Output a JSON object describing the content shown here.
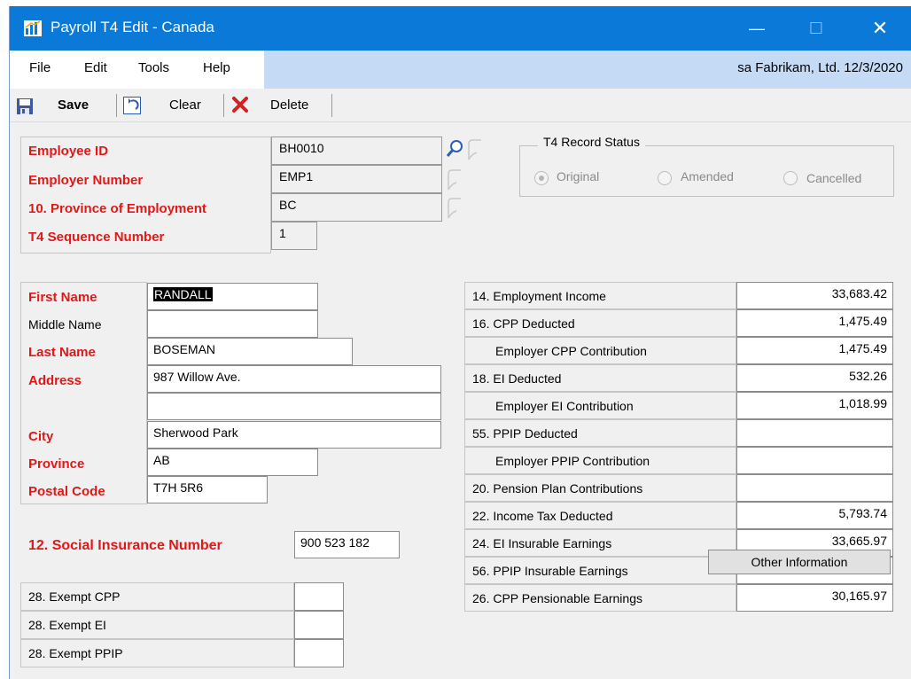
{
  "window": {
    "title": "Payroll T4 Edit - Canada",
    "controls": {
      "minimize": "—",
      "maximize": "☐",
      "close": "✕"
    }
  },
  "menu": {
    "items": [
      "File",
      "Edit",
      "Tools",
      "Help"
    ],
    "status": "sa  Fabrikam, Ltd.  12/3/2020"
  },
  "toolbar": {
    "save": "Save",
    "clear": "Clear",
    "delete": "Delete"
  },
  "header": {
    "employee_id_label": "Employee ID",
    "employee_id": "BH0010",
    "employer_number_label": "Employer Number",
    "employer_number": "EMP1",
    "province_employment_label": "10. Province of Employment",
    "province_employment": "BC",
    "sequence_label": "T4 Sequence Number",
    "sequence": "1"
  },
  "record_status": {
    "label": "T4 Record Status",
    "options": [
      "Original",
      "Amended",
      "Cancelled"
    ],
    "selected": "Original"
  },
  "employee": {
    "first_name_label": "First Name",
    "first_name": "RANDALL",
    "middle_name_label": "Middle Name",
    "middle_name": "",
    "last_name_label": "Last Name",
    "last_name": "BOSEMAN",
    "address_label": "Address",
    "address_1": "987 Willow Ave.",
    "address_2": "",
    "city_label": "City",
    "city": "Sherwood Park",
    "province_label": "Province",
    "province": "AB",
    "postal_code_label": "Postal Code",
    "postal_code": "T7H 5R6",
    "sin_label": "12. Social Insurance Number",
    "sin": "900 523 182"
  },
  "exempt": [
    {
      "label": "28. Exempt CPP",
      "value": ""
    },
    {
      "label": "28. Exempt EI",
      "value": ""
    },
    {
      "label": "28. Exempt PPIP",
      "value": ""
    }
  ],
  "amounts": [
    {
      "label": "14. Employment Income",
      "value": "33,683.42",
      "indent": false
    },
    {
      "label": "16. CPP Deducted",
      "value": "1,475.49",
      "indent": false
    },
    {
      "label": "Employer CPP Contribution",
      "value": "1,475.49",
      "indent": true
    },
    {
      "label": "18. EI Deducted",
      "value": "532.26",
      "indent": false
    },
    {
      "label": "Employer EI Contribution",
      "value": "1,018.99",
      "indent": true
    },
    {
      "label": "55. PPIP Deducted",
      "value": "",
      "indent": false
    },
    {
      "label": "Employer PPIP Contribution",
      "value": "",
      "indent": true
    },
    {
      "label": "20. Pension Plan Contributions",
      "value": "",
      "indent": false
    },
    {
      "label": "22. Income Tax Deducted",
      "value": "5,793.74",
      "indent": false
    },
    {
      "label": "24. EI Insurable Earnings",
      "value": "33,665.97",
      "indent": false
    },
    {
      "label": "56. PPIP Insurable Earnings",
      "value": "",
      "indent": false
    },
    {
      "label": "26. CPP Pensionable Earnings",
      "value": "30,165.97",
      "indent": false
    }
  ],
  "buttons": {
    "other_information": "Other Information"
  },
  "colors": {
    "title_bar": "#0a79d8",
    "menu_right": "#c4daf5",
    "required_label": "#e01818"
  }
}
